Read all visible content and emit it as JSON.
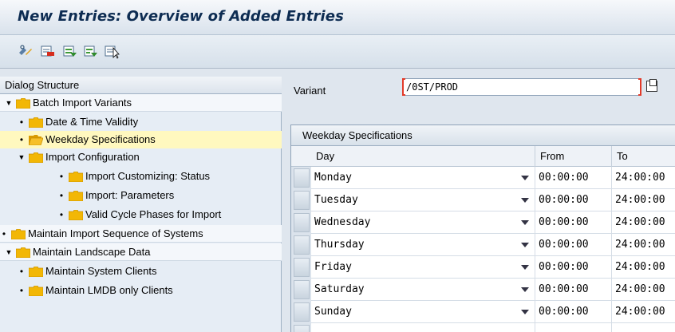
{
  "window": {
    "title": "New Entries: Overview of Added Entries"
  },
  "toolbar": {
    "buttons": [
      {
        "icon": "display-change-icon"
      },
      {
        "icon": "delete-icon"
      },
      {
        "icon": "select-all-icon"
      },
      {
        "icon": "select-block-icon"
      },
      {
        "icon": "deselect-all-icon"
      }
    ]
  },
  "dialog_structure": {
    "header": "Dialog Structure",
    "items": [
      {
        "label": "Batch Import Variants",
        "level": 0,
        "expanded": true
      },
      {
        "label": "Date & Time Validity",
        "level": 1
      },
      {
        "label": "Weekday Specifications",
        "level": 1,
        "selected": true,
        "open_folder": true
      },
      {
        "label": "Import Configuration",
        "level": 1,
        "expanded": true
      },
      {
        "label": "Import Customizing: Status",
        "level": 2
      },
      {
        "label": "Import: Parameters",
        "level": 2
      },
      {
        "label": "Valid Cycle Phases for Import",
        "level": 2
      },
      {
        "label": "Maintain Import Sequence of Systems",
        "level": 0
      },
      {
        "label": "Maintain Landscape Data",
        "level": 0,
        "expanded": true
      },
      {
        "label": "Maintain System Clients",
        "level": 1
      },
      {
        "label": "Maintain LMDB only Clients",
        "level": 1
      }
    ]
  },
  "variant": {
    "label": "Variant",
    "value": "/0ST/PROD"
  },
  "table": {
    "title": "Weekday Specifications",
    "columns": [
      "Day",
      "From",
      "To"
    ],
    "rows": [
      {
        "day": "Monday",
        "from": "00:00:00",
        "to": "24:00:00"
      },
      {
        "day": "Tuesday",
        "from": "00:00:00",
        "to": "24:00:00"
      },
      {
        "day": "Wednesday",
        "from": "00:00:00",
        "to": "24:00:00"
      },
      {
        "day": "Thursday",
        "from": "00:00:00",
        "to": "24:00:00"
      },
      {
        "day": "Friday",
        "from": "00:00:00",
        "to": "24:00:00"
      },
      {
        "day": "Saturday",
        "from": "00:00:00",
        "to": "24:00:00"
      },
      {
        "day": "Sunday",
        "from": "00:00:00",
        "to": "24:00:00"
      },
      {
        "day": "",
        "from": "",
        "to": ""
      }
    ]
  },
  "colors": {
    "title": "#0d2c52",
    "selected_row": "#fff8bf",
    "folder": "#f2b705",
    "required": "#e23b2a"
  }
}
